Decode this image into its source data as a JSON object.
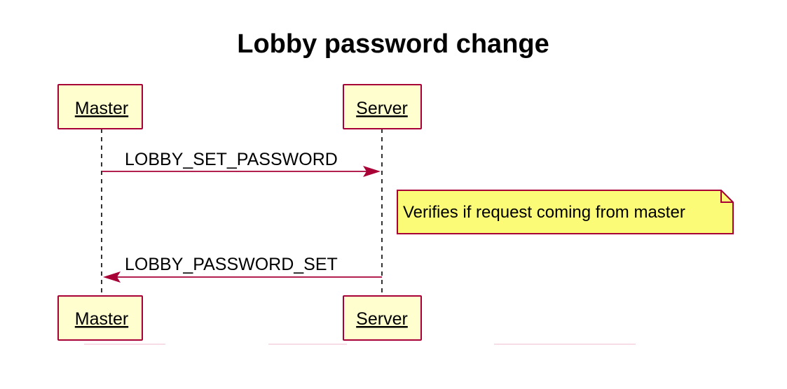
{
  "diagram": {
    "title": "Lobby password change",
    "participants": [
      {
        "id": "master",
        "label": "Master"
      },
      {
        "id": "server",
        "label": "Server"
      }
    ],
    "messages": [
      {
        "from": "master",
        "to": "server",
        "label": "LOBBY_SET_PASSWORD"
      },
      {
        "from": "server",
        "to": "master",
        "label": "LOBBY_PASSWORD_SET"
      }
    ],
    "note": {
      "over": "server",
      "text": "Verifies if request coming from master"
    },
    "colors": {
      "participant_fill": "#fefece",
      "participant_border": "#a80036",
      "arrow": "#a80036",
      "note_fill": "#fbfb77",
      "note_border": "#a80036"
    }
  }
}
